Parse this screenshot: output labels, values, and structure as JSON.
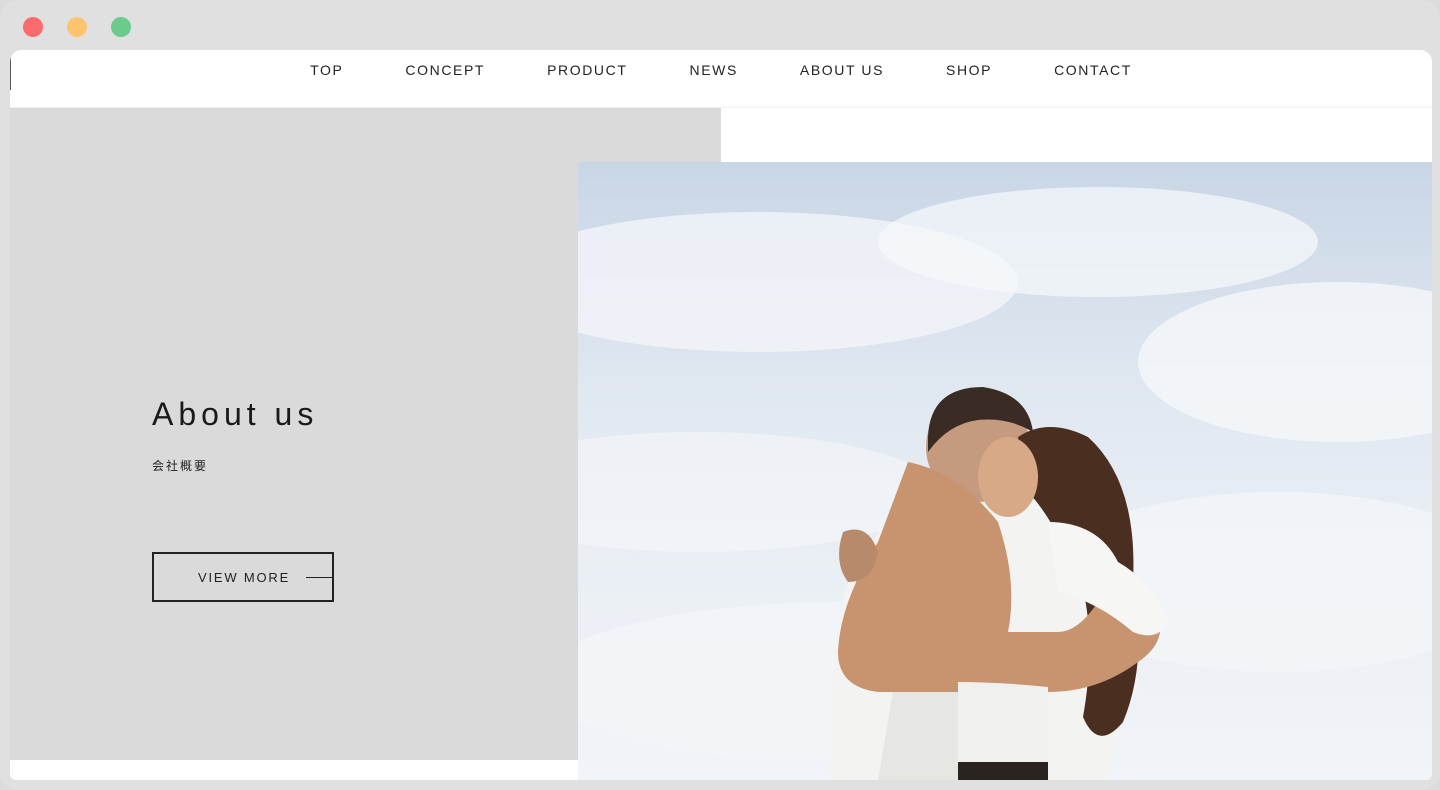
{
  "nav": {
    "items": [
      "TOP",
      "CONCEPT",
      "PRODUCT",
      "NEWS",
      "ABOUT US",
      "SHOP",
      "CONTACT"
    ]
  },
  "hero": {
    "title": "About us",
    "subtitle": "会社概要",
    "button_label": "VIEW MORE"
  },
  "colors": {
    "panel_gray": "#dadada",
    "text_dark": "#1a1a1a",
    "traffic_red": "#fc6b6b",
    "traffic_yellow": "#fdc46e",
    "traffic_green": "#6bcb8b"
  }
}
